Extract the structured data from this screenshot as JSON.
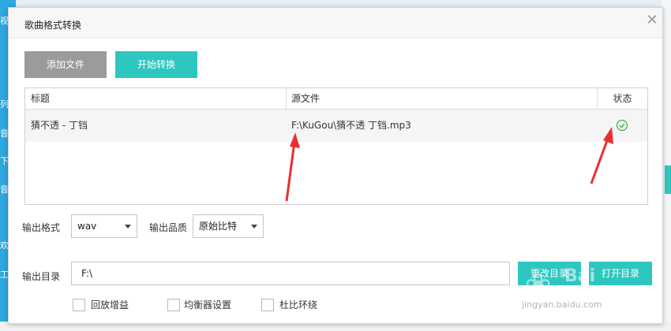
{
  "background": {
    "left_strip_chars": [
      "视",
      "列",
      "音",
      "下",
      "音",
      "欢",
      "工"
    ],
    "left_color": "#2ea8de",
    "accent_bar_color": "#2ec7c0"
  },
  "dialog": {
    "title": "歌曲格式转换",
    "close_glyph": "✕"
  },
  "toolbar": {
    "add_file_label": "添加文件",
    "start_convert_label": "开始转换"
  },
  "table": {
    "headers": [
      "标题",
      "源文件",
      "状态"
    ],
    "rows": [
      {
        "title": "猜不透 - 丁铛",
        "source": "F:\\KuGou\\猜不透 丁铛.mp3",
        "status": "done-check"
      }
    ]
  },
  "options": {
    "format_label": "输出格式",
    "format_value": "wav",
    "quality_label": "输出品质",
    "quality_value": "原始比特",
    "dir_label": "输出目录",
    "dir_value": "F:\\",
    "change_dir_label": "更改目录",
    "open_dir_label": "打开目录"
  },
  "checkboxes": [
    {
      "label": "回放增益",
      "checked": false
    },
    {
      "label": "均衡器设置",
      "checked": false
    },
    {
      "label": "杜比环绕",
      "checked": false
    }
  ],
  "watermark": {
    "brand": "Bai",
    "url": "jingyan.baidu.com"
  },
  "colors": {
    "accent": "#2ec7c0",
    "disabled_button": "#9b9b9b",
    "check_green": "#3cb44b",
    "annotation_arrow": "#e8312f"
  }
}
